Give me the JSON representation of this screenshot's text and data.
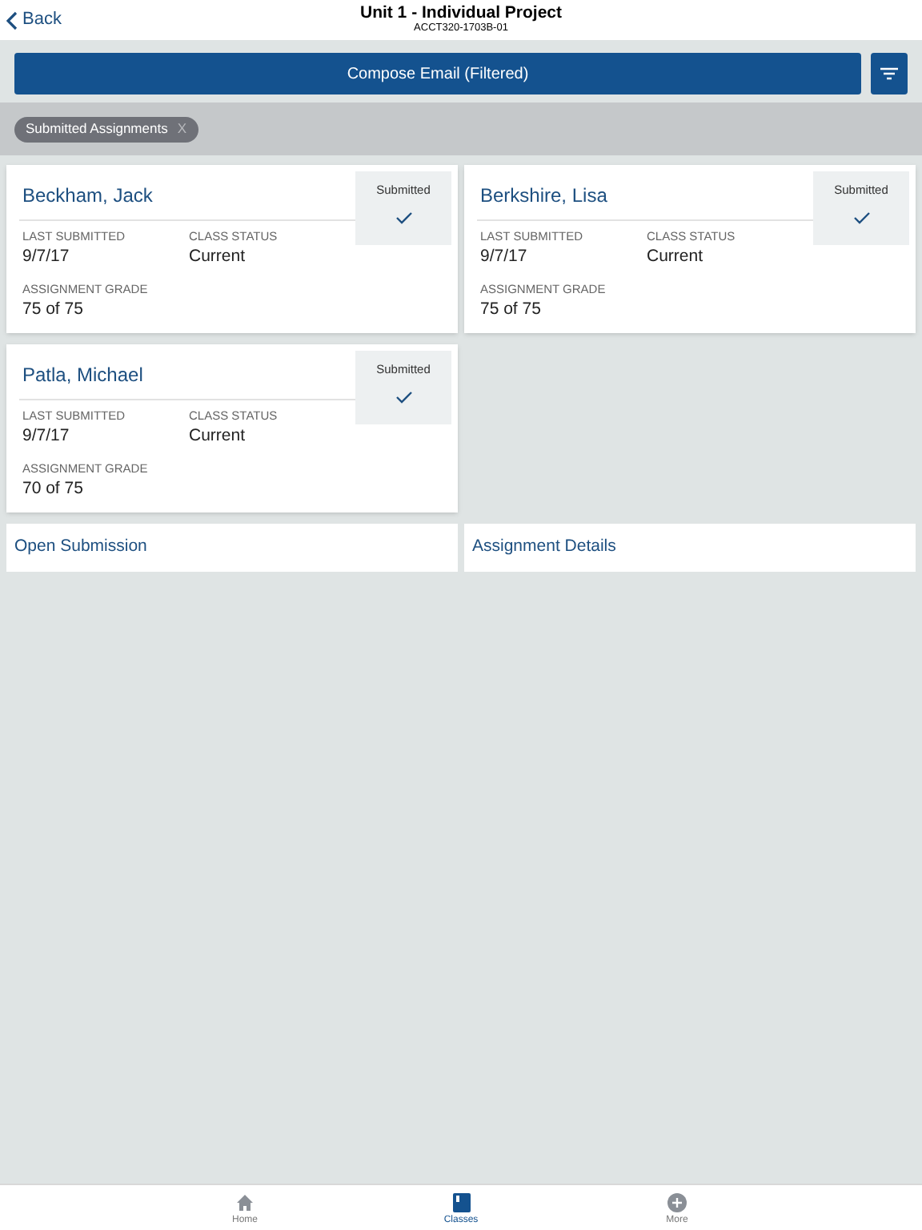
{
  "header": {
    "back": "Back",
    "title": "Unit 1 - Individual Project",
    "subtitle": "ACCT320-1703B-01"
  },
  "compose_button": "Compose Email (Filtered)",
  "filter_chips": [
    {
      "label": "Submitted Assignments",
      "remove": "X"
    }
  ],
  "students": [
    {
      "name": "Beckham, Jack",
      "status": "Submitted",
      "submitted": true,
      "last_submitted_label": "LAST SUBMITTED",
      "last_submitted": "9/7/17",
      "class_status_label": "CLASS STATUS",
      "class_status": "Current",
      "grade_label": "ASSIGNMENT GRADE",
      "grade": "75 of 75"
    },
    {
      "name": "Berkshire, Lisa",
      "status": "Submitted",
      "submitted": true,
      "last_submitted_label": "LAST SUBMITTED",
      "last_submitted": "9/7/17",
      "class_status_label": "CLASS STATUS",
      "class_status": "Current",
      "grade_label": "ASSIGNMENT GRADE",
      "grade": "75 of 75"
    },
    {
      "name": "Patla, Michael",
      "status": "Submitted",
      "submitted": true,
      "last_submitted_label": "LAST SUBMITTED",
      "last_submitted": "9/7/17",
      "class_status_label": "CLASS STATUS",
      "class_status": "Current",
      "grade_label": "ASSIGNMENT GRADE",
      "grade": "70 of 75"
    }
  ],
  "actions": [
    "Open Submission",
    "Assignment Details"
  ],
  "tab_bar": [
    {
      "label": "Home",
      "kind": "home",
      "selected": false
    },
    {
      "label": "Classes",
      "kind": "classes",
      "selected": true
    },
    {
      "label": "More",
      "kind": "more",
      "selected": false
    }
  ]
}
